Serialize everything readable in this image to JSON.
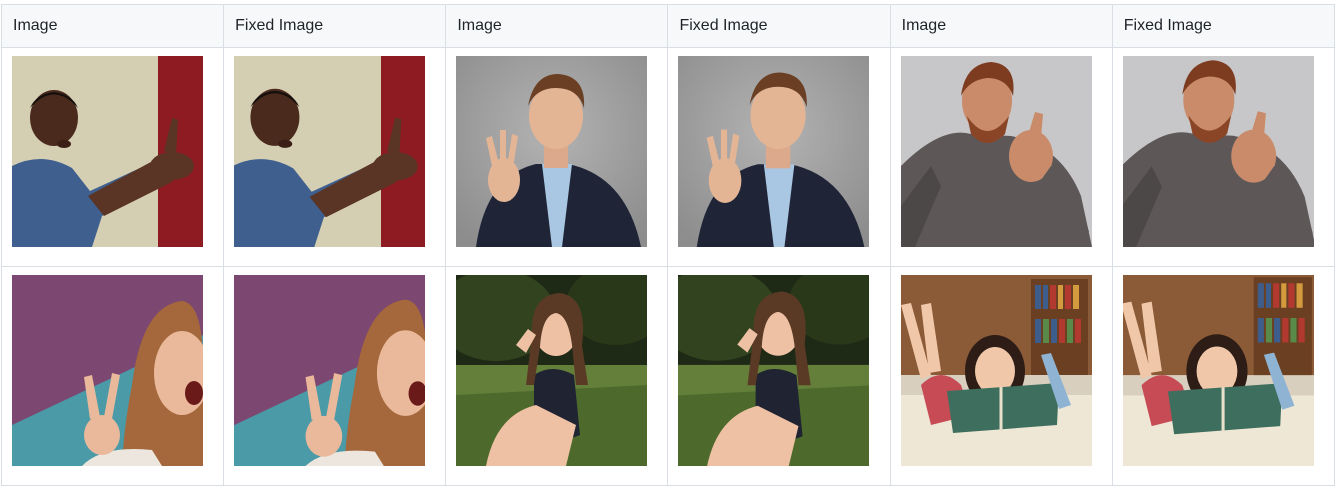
{
  "table": {
    "headers": [
      "Image",
      "Fixed Image",
      "Image",
      "Fixed Image",
      "Image",
      "Fixed Image"
    ],
    "rows": [
      {
        "cells": [
          {
            "kind": "original",
            "scene": "man-red-wall"
          },
          {
            "kind": "fixed",
            "scene": "man-red-wall"
          },
          {
            "kind": "original",
            "scene": "man-blazer-wave"
          },
          {
            "kind": "fixed",
            "scene": "man-blazer-wave"
          },
          {
            "kind": "original",
            "scene": "bearded-man-thumbs-up"
          },
          {
            "kind": "fixed",
            "scene": "bearded-man-thumbs-up"
          }
        ]
      },
      {
        "cells": [
          {
            "kind": "original",
            "scene": "woman-peace-sign"
          },
          {
            "kind": "fixed",
            "scene": "woman-peace-sign"
          },
          {
            "kind": "original",
            "scene": "girl-sitting-grass"
          },
          {
            "kind": "fixed",
            "scene": "girl-sitting-grass"
          },
          {
            "kind": "original",
            "scene": "girl-reading-bookshelf"
          },
          {
            "kind": "fixed",
            "scene": "girl-reading-bookshelf"
          }
        ]
      }
    ]
  },
  "colors": {
    "header_bg": "#f6f8fa",
    "border": "#d8dee4",
    "text": "#1f2328"
  }
}
